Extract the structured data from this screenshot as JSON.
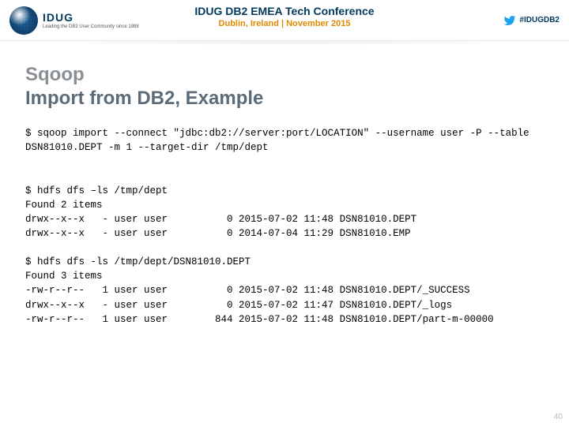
{
  "header": {
    "logo_main": "IDUG",
    "logo_sub": "Leading the DB2 User Community since 1988",
    "conf_title": "IDUG DB2 EMEA Tech Conference",
    "conf_sub": "Dublin, Ireland | November 2015",
    "hashtag": "#IDUGDB2"
  },
  "title": {
    "line1": "Sqoop",
    "line2": "Import from DB2, Example"
  },
  "code": "$ sqoop import --connect \"jdbc:db2://server:port/LOCATION\" --username user -P --table\nDSN81010.DEPT -m 1 --target-dir /tmp/dept\n\n\n$ hdfs dfs –ls /tmp/dept\nFound 2 items\ndrwx--x--x   - user user          0 2015-07-02 11:48 DSN81010.DEPT\ndrwx--x--x   - user user          0 2014-07-04 11:29 DSN81010.EMP\n\n$ hdfs dfs -ls /tmp/dept/DSN81010.DEPT\nFound 3 items\n-rw-r--r--   1 user user          0 2015-07-02 11:48 DSN81010.DEPT/_SUCCESS\ndrwx--x--x   - user user          0 2015-07-02 11:47 DSN81010.DEPT/_logs\n-rw-r--r--   1 user user        844 2015-07-02 11:48 DSN81010.DEPT/part-m-00000",
  "slide_number": "40"
}
